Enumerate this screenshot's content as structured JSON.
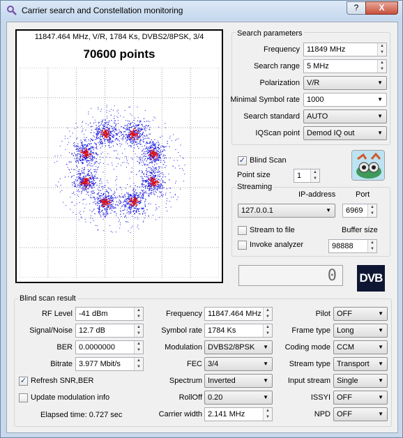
{
  "window": {
    "title": "Carrier search and Constellation monitoring",
    "help_label": "?",
    "close_label": "X"
  },
  "constellation": {
    "info": "11847.464 MHz, V/R, 1784 Ks, DVBS2/8PSK, 3/4",
    "points": "70600 points"
  },
  "search": {
    "group_label": "Search parameters",
    "frequency_label": "Frequency",
    "frequency_value": "11849 MHz",
    "range_label": "Search range",
    "range_value": "5 MHz",
    "polarization_label": "Polarization",
    "polarization_value": "V/R",
    "min_sr_label": "Minimal Symbol rate",
    "min_sr_value": "1000",
    "standard_label": "Search standard",
    "standard_value": "AUTO",
    "iqscan_label": "IQScan point",
    "iqscan_value": "Demod IQ out"
  },
  "blind_scan": {
    "label": "Blind Scan",
    "checked": true
  },
  "point_size": {
    "label": "Point size",
    "value": "1"
  },
  "streaming": {
    "group_label": "Streaming",
    "ip_header": "IP-address",
    "port_header": "Port",
    "ip_value": "127.0.0.1",
    "port_value": "6969",
    "stream_to_file_label": "Stream to file",
    "buffer_size_label": "Buffer size",
    "invoke_analyzer_label": "Invoke analyzer",
    "buffer_size_value": "98888"
  },
  "lcd_value": "0",
  "dvb_logo": "DVB",
  "result": {
    "group_label": "Blind scan result",
    "rf_level_label": "RF Level",
    "rf_level_value": "-41 dBm",
    "snr_label": "Signal/Noise",
    "snr_value": "12.7 dB",
    "ber_label": "BER",
    "ber_value": "0.0000000",
    "bitrate_label": "Bitrate",
    "bitrate_value": "3.977 Mbit/s",
    "frequency_label": "Frequency",
    "frequency_value": "11847.464 MHz",
    "symbol_rate_label": "Symbol rate",
    "symbol_rate_value": "1784 Ks",
    "modulation_label": "Modulation",
    "modulation_value": "DVBS2/8PSK",
    "fec_label": "FEC",
    "fec_value": "3/4",
    "spectrum_label": "Spectrum",
    "spectrum_value": "Inverted",
    "rolloff_label": "RollOff",
    "rolloff_value": "0.20",
    "carrier_width_label": "Carrier width",
    "carrier_width_value": "2.141 MHz",
    "pilot_label": "Pilot",
    "pilot_value": "OFF",
    "frame_type_label": "Frame type",
    "frame_type_value": "Long",
    "coding_mode_label": "Coding mode",
    "coding_mode_value": "CCM",
    "stream_type_label": "Stream type",
    "stream_type_value": "Transport",
    "input_stream_label": "Input stream",
    "input_stream_value": "Single",
    "issyi_label": "ISSYI",
    "issyi_value": "OFF",
    "npd_label": "NPD",
    "npd_value": "OFF",
    "refresh_label": "Refresh SNR,BER",
    "refresh_checked": true,
    "update_mod_label": "Update modulation info",
    "update_mod_checked": false,
    "elapsed": "Elapsed time: 0.727 sec"
  },
  "colors": {
    "window_frame": "#c9d9ec",
    "scatter_blue": "#1010e0",
    "scatter_red": "#e01010"
  }
}
